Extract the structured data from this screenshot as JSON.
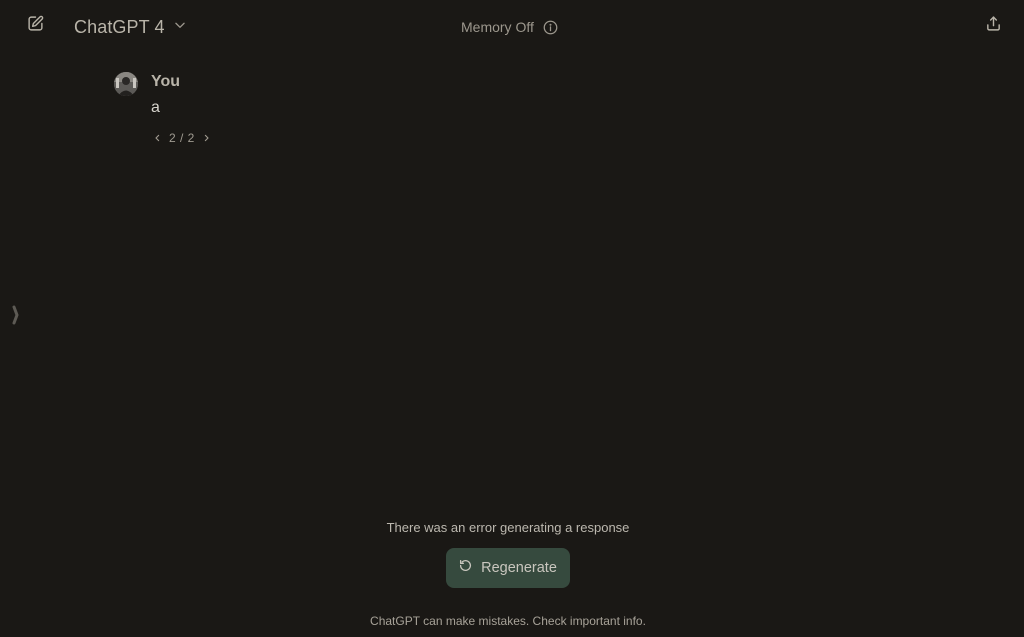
{
  "header": {
    "model_name": "ChatGPT 4",
    "memory_status": "Memory Off",
    "icons": {
      "new_chat": "edit-icon",
      "model_dropdown": "chevron-down-icon",
      "info": "info-icon",
      "share": "share-icon"
    }
  },
  "conversation": {
    "messages": [
      {
        "author": "You",
        "text": "a",
        "avatar": "user-avatar",
        "pager": {
          "count": "2 / 2",
          "prev_icon": "chevron-left-icon",
          "next_icon": "chevron-right-icon"
        }
      }
    ]
  },
  "sidebar": {
    "toggle_icon": "sidebar-toggle-icon"
  },
  "error": {
    "message": "There was an error generating a response",
    "regenerate_label": "Regenerate",
    "regenerate_icon": "refresh-icon"
  },
  "footer": {
    "disclaimer": "ChatGPT can make mistakes. Check important info."
  },
  "colors": {
    "background": "#1a1815",
    "regenerate_button": "#364a3e",
    "primary_text": "#d6d3cc",
    "muted_text": "#9c978d"
  }
}
